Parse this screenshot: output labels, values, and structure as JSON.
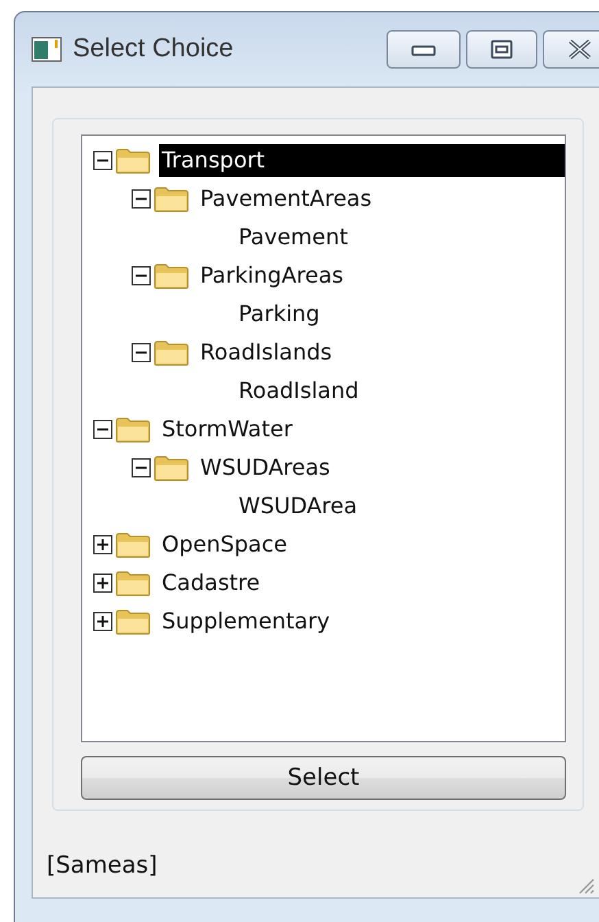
{
  "window": {
    "title": "Select Choice"
  },
  "tree": [
    {
      "kind": "folder",
      "label": "Transport",
      "expanded": true,
      "selected": true,
      "children": [
        {
          "kind": "folder",
          "label": "PavementAreas",
          "expanded": true,
          "selected": false,
          "children": [
            {
              "kind": "leaf",
              "label": "Pavement",
              "selected": false
            }
          ]
        },
        {
          "kind": "folder",
          "label": "ParkingAreas",
          "expanded": true,
          "selected": false,
          "children": [
            {
              "kind": "leaf",
              "label": "Parking",
              "selected": false
            }
          ]
        },
        {
          "kind": "folder",
          "label": "RoadIslands",
          "expanded": true,
          "selected": false,
          "children": [
            {
              "kind": "leaf",
              "label": "RoadIsland",
              "selected": false
            }
          ]
        }
      ]
    },
    {
      "kind": "folder",
      "label": "StormWater",
      "expanded": true,
      "selected": false,
      "children": [
        {
          "kind": "folder",
          "label": "WSUDAreas",
          "expanded": true,
          "selected": false,
          "children": [
            {
              "kind": "leaf",
              "label": "WSUDArea",
              "selected": false
            }
          ]
        }
      ]
    },
    {
      "kind": "folder",
      "label": "OpenSpace",
      "expanded": false,
      "selected": false
    },
    {
      "kind": "folder",
      "label": "Cadastre",
      "expanded": false,
      "selected": false
    },
    {
      "kind": "folder",
      "label": "Supplementary",
      "expanded": false,
      "selected": false
    }
  ],
  "select_button": "Select",
  "status": "[Sameas]"
}
